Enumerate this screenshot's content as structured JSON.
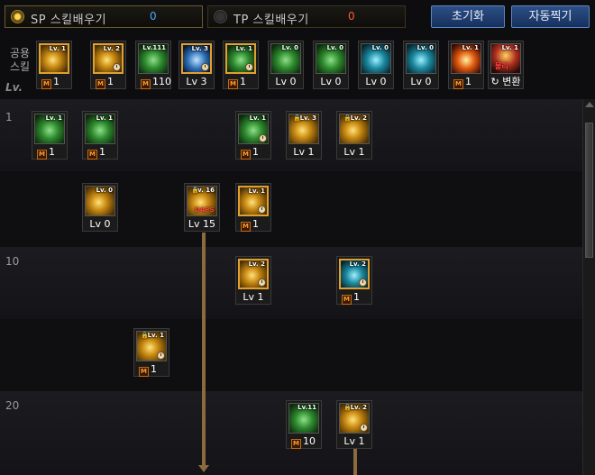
{
  "header": {
    "sp_tab": {
      "label": "SP 스킬배우기",
      "value": "0"
    },
    "tp_tab": {
      "label": "TP 스킬배우기",
      "value": "0"
    },
    "reset_button": "초기화",
    "auto_button": "자동찍기"
  },
  "common": {
    "label_line1": "공용",
    "label_line2": "스킬",
    "lv_label": "Lv.",
    "skills": [
      {
        "icon": "running-icon",
        "color": "yellow",
        "top": "Lv. 1",
        "foot": "1",
        "master": true,
        "selected": true
      },
      {
        "icon": "kneeling-icon",
        "color": "yellow",
        "top": "Lv. 2",
        "foot": "1",
        "master": true,
        "selected": true,
        "clock": true
      },
      {
        "icon": "slash-icon",
        "color": "green",
        "top": "Lv.111",
        "foot": "110",
        "master": true
      },
      {
        "icon": "wing-icon",
        "color": "blue",
        "top": "Lv. 3",
        "foot": "Lv 3",
        "master": false,
        "selected": true,
        "clock": true
      },
      {
        "icon": "dash-icon",
        "color": "green",
        "top": "Lv. 1",
        "foot": "1",
        "master": true,
        "selected": true,
        "clock": true
      },
      {
        "icon": "target-icon",
        "color": "green",
        "top": "Lv. 0",
        "foot": "Lv 0",
        "master": false
      },
      {
        "icon": "beast-icon",
        "color": "green",
        "top": "Lv. 0",
        "foot": "Lv 0",
        "master": false
      },
      {
        "icon": "eye-icon",
        "color": "teal",
        "top": "Lv. 0",
        "foot": "Lv 0",
        "master": false
      },
      {
        "icon": "armor-icon",
        "color": "teal",
        "top": "Lv. 0",
        "foot": "Lv 0",
        "master": false
      },
      {
        "icon": "flame-icon",
        "color": "fire",
        "top": "Lv. 1",
        "foot": "1",
        "master": true
      },
      {
        "icon": "physical-icon",
        "color": "mixed",
        "top": "Lv. 1",
        "foot": "변환",
        "master": false,
        "convert": true,
        "tag": "물리"
      }
    ]
  },
  "levels": [
    "1",
    "10",
    "20"
  ],
  "tree": [
    {
      "icon": "kick-icon",
      "color": "green",
      "top": "Lv. 1",
      "foot": "1",
      "master": true
    },
    {
      "icon": "flag-icon",
      "color": "green",
      "top": "Lv. 1",
      "foot": "1",
      "master": true
    },
    {
      "icon": "gun-icon",
      "color": "green",
      "top": "Lv. 1",
      "foot": "1",
      "master": true,
      "clock": true
    },
    {
      "icon": "burst-icon",
      "color": "yellow",
      "top": "Lv. 3",
      "foot": "Lv 1",
      "lock": true
    },
    {
      "icon": "arrow-rain-icon",
      "color": "yellow",
      "top": "Lv. 2",
      "foot": "Lv 1",
      "lock": true
    },
    {
      "icon": "dodge-icon",
      "color": "yellow",
      "top": "Lv. 0",
      "foot": "Lv 0"
    },
    {
      "icon": "critical-icon",
      "color": "yellow",
      "top": "Lv. 16",
      "foot": "Lv 15",
      "lock": true,
      "tag": "DAPS"
    },
    {
      "icon": "pistol-icon",
      "color": "yellow",
      "top": "Lv. 1",
      "foot": "1",
      "master": true,
      "selected": true,
      "clock": true
    },
    {
      "icon": "spin-icon",
      "color": "yellow",
      "top": "Lv. 2",
      "foot": "Lv 1",
      "selected": true,
      "clock": true
    },
    {
      "icon": "shield-icon",
      "color": "teal",
      "top": "Lv. 2",
      "foot": "1",
      "master": true,
      "selected": true,
      "clock": true
    },
    {
      "icon": "rush-icon",
      "color": "yellow",
      "top": "Lv. 1",
      "foot": "1",
      "master": true,
      "lock": true,
      "clock": true
    },
    {
      "icon": "bow-icon",
      "color": "green",
      "top": "Lv.11",
      "foot": "10",
      "master": true
    },
    {
      "icon": "totem-icon",
      "color": "yellow",
      "top": "Lv. 2",
      "foot": "Lv 1",
      "lock": true,
      "clock": true
    }
  ],
  "master_mark": "M"
}
